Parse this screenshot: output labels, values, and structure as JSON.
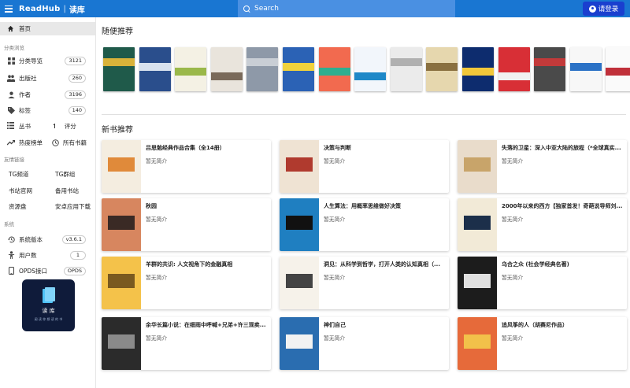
{
  "header": {
    "brand": "ReadHub",
    "brand_sub": "读库",
    "search_placeholder": "Search",
    "login_label": "请登录",
    "color": "#1976d2"
  },
  "sidebar": {
    "home": "首页",
    "browse_label": "分类浏览",
    "browse": [
      {
        "label": "分类导览",
        "count": "3121",
        "icon": "grid-icon"
      },
      {
        "label": "出版社",
        "count": "260",
        "icon": "people-icon"
      },
      {
        "label": "作者",
        "count": "3196",
        "icon": "person-icon"
      },
      {
        "label": "标签",
        "count": "140",
        "icon": "tag-icon"
      }
    ],
    "series_label": "丛书",
    "rating_label": "评分",
    "rank_label": "热度榜单",
    "all_books_label": "所有书籍",
    "links_label": "友情链接",
    "links": [
      "TG频道",
      "TG群组",
      "书站官网",
      "备用书站",
      "资源盘",
      "安卓应用下载"
    ],
    "system_label": "系统",
    "system": [
      {
        "label": "系统版本",
        "value": "v3.6.1",
        "icon": "history-icon"
      },
      {
        "label": "用户数",
        "value": "1",
        "icon": "user-icon"
      },
      {
        "label": "OPDS接口",
        "value": "OPDS",
        "icon": "phone-icon"
      }
    ],
    "app_logo_title": "读 库",
    "app_logo_subtitle": "阅 读 你 想 读 的 书"
  },
  "random": {
    "title": "随便推荐",
    "covers": [
      {
        "bg": "#1f5a4a",
        "accent": "#d9b23a"
      },
      {
        "bg": "#2a4e8c",
        "accent": "#d8e2ef"
      },
      {
        "bg": "#f4f1e4",
        "accent": "#9ab84a"
      },
      {
        "bg": "#e9e4dc",
        "accent": "#7a6a5a"
      },
      {
        "bg": "#8e99a8",
        "accent": "#c9ced5"
      },
      {
        "bg": "#2b62b5",
        "accent": "#f0d23c"
      },
      {
        "bg": "#f26a4f",
        "accent": "#2fae8f"
      },
      {
        "bg": "#f2f6fb",
        "accent": "#1e88c8"
      },
      {
        "bg": "#ebebeb",
        "accent": "#b0b0b0"
      },
      {
        "bg": "#e6d7ae",
        "accent": "#8a7040"
      },
      {
        "bg": "#0d2c6e",
        "accent": "#f2c83a"
      },
      {
        "bg": "#d82f36",
        "accent": "#f1f1f1"
      },
      {
        "bg": "#4a4a4a",
        "accent": "#c23a3a"
      },
      {
        "bg": "#f7f7f7",
        "accent": "#2b72c6"
      },
      {
        "bg": "#fafafa",
        "accent": "#c0303a"
      }
    ]
  },
  "new_books": {
    "title": "新书推荐",
    "books": [
      {
        "title": "吕思勉经典作品合集（全14册）",
        "desc": "暂无简介",
        "bg": "#f4ede0",
        "accent": "#e08a3a"
      },
      {
        "title": "决策与判断",
        "desc": "暂无简介",
        "bg": "#efe3d3",
        "accent": "#b03a2e"
      },
      {
        "title": "失落的卫星：深入中亚大陆的旅程（*全球真实...",
        "desc": "暂无简介",
        "bg": "#e9dccb",
        "accent": "#c8a46a"
      },
      {
        "title": "秋园",
        "desc": "暂无简介",
        "bg": "#d7865f",
        "accent": "#3a2a25"
      },
      {
        "title": "人生算法：用概率思维做好决策",
        "desc": "暂无简介",
        "bg": "#1f7fc1",
        "accent": "#111111"
      },
      {
        "title": "2000年以来的西方【独家首发！奇葩说导师刘...",
        "desc": "暂无简介",
        "bg": "#f2ead7",
        "accent": "#1c2f4a"
      },
      {
        "title": "羊群的共识: 人文视角下的金融真相",
        "desc": "暂无简介",
        "bg": "#f4c24a",
        "accent": "#7a5a20"
      },
      {
        "title": "洞见：从科学到哲学，打开人类的认知真相（...",
        "desc": "暂无简介",
        "bg": "#f6f2ea",
        "accent": "#444444"
      },
      {
        "title": "乌合之众 (社会学经典名著)",
        "desc": "暂无简介",
        "bg": "#1c1c1c",
        "accent": "#e0e0e0"
      },
      {
        "title": "余华长篇小说：在细雨中呼喊+兄弟+许三观卖...",
        "desc": "暂无简介",
        "bg": "#2b2b2b",
        "accent": "#8a8a8a"
      },
      {
        "title": "神们自己",
        "desc": "暂无简介",
        "bg": "#2a6db0",
        "accent": "#f2f2f2"
      },
      {
        "title": "追风筝的人（胡赛尼作品）",
        "desc": "暂无简介",
        "bg": "#e66a3a",
        "accent": "#f2c14a"
      }
    ]
  }
}
